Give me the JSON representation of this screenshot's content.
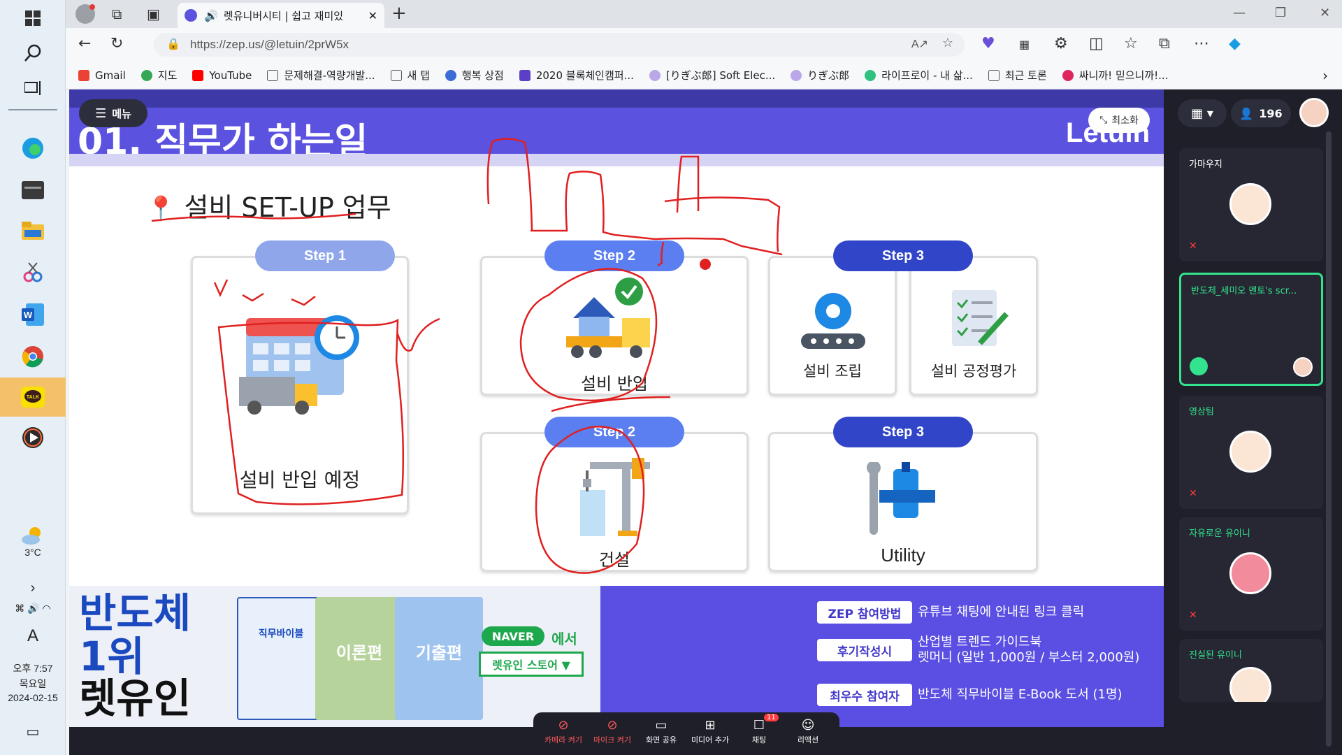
{
  "taskbar": {
    "weather": "3°C",
    "ime": "A",
    "time": "오후 7:57",
    "day": "목요일",
    "date": "2024-02-15"
  },
  "browser": {
    "tab_title": "렛유니버시티 | 쉽고 재미있",
    "url": "https://zep.us/@letuin/2prW5x",
    "bookmarks": [
      {
        "label": "Gmail",
        "color": "#ea4335"
      },
      {
        "label": "지도",
        "color": "#34a853"
      },
      {
        "label": "YouTube",
        "color": "#ff0000"
      },
      {
        "label": "문제해결-역량개발...",
        "color": "#888888"
      },
      {
        "label": "새 탭",
        "color": "#888888"
      },
      {
        "label": "행복 상점",
        "color": "#3a6bd6"
      },
      {
        "label": "2020 블록체인캠퍼...",
        "color": "#5b3fc4"
      },
      {
        "label": "[りぎぶ郎] Soft Elec...",
        "color": "#b9a7e8"
      },
      {
        "label": "りぎぶ郎",
        "color": "#b9a7e8"
      },
      {
        "label": "라이프로이 - 내 삶...",
        "color": "#2ec27e"
      },
      {
        "label": "최근 토론",
        "color": "#888888"
      },
      {
        "label": "싸니까! 믿으니까!...",
        "color": "#e0245e"
      }
    ]
  },
  "zep": {
    "menu_label": "메뉴",
    "minimize_label": "최소화",
    "user_count": "196"
  },
  "slide": {
    "title": "01. 직무가 하는일",
    "brand": "Letuin",
    "section_title": "설비 SET-UP 업무",
    "steps": [
      {
        "pill": "Step 1",
        "label": "설비 반입 예정"
      },
      {
        "pill": "Step 2",
        "label": "설비 반입"
      },
      {
        "pill": "Step 3",
        "label": "설비 조립"
      },
      {
        "label": "설비 공정평가"
      },
      {
        "pill": "Step 2",
        "label": "건설"
      },
      {
        "pill": "Step 3",
        "label": "Utility"
      }
    ]
  },
  "banner": {
    "headline_1": "반도체",
    "headline_2": "1위",
    "headline_3": "렛유인",
    "books": [
      "직무바이블",
      "이론편",
      "기출편"
    ],
    "naver": "NAVER",
    "naver_suffix": "에서",
    "store": "렛유인 스토어 ▼",
    "info": [
      {
        "pill": "ZEP 참여방법",
        "text": "유튜브 채팅에 안내된 링크 클릭"
      },
      {
        "pill": "후기작성시",
        "text": "산업별 트렌드 가이드북",
        "text2": "렛머니 (일반 1,000원 / 부스터 2,000원)"
      },
      {
        "pill": "최우수 참여자",
        "text": "반도체 직무바이블 E-Book 도서 (1명)"
      }
    ]
  },
  "toolbar": {
    "items": [
      {
        "label": "카메라 켜기",
        "state": "off"
      },
      {
        "label": "마이크 켜기",
        "state": "off"
      },
      {
        "label": "화면 공유"
      },
      {
        "label": "미디어 추가"
      },
      {
        "label": "채팅",
        "badge": "11"
      },
      {
        "label": "리액션"
      }
    ]
  },
  "participants": [
    {
      "name": "가마우지"
    },
    {
      "name": "반도체_세미오 멘토's scr..."
    },
    {
      "name": "영상팀"
    },
    {
      "name": "자유로운 유이니"
    },
    {
      "name": "진실된 유이니"
    }
  ]
}
